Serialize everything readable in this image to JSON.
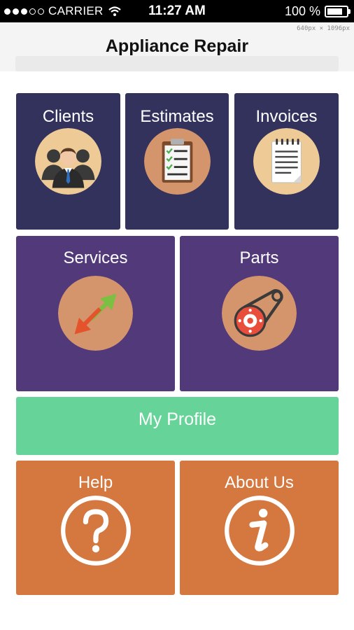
{
  "status_bar": {
    "carrier": "CARRIER",
    "time": "11:27 AM",
    "battery": "100 %"
  },
  "header": {
    "title": "Appliance Repair",
    "dimension_note": "640px × 1096px"
  },
  "tiles": {
    "clients": "Clients",
    "estimates": "Estimates",
    "invoices": "Invoices",
    "services": "Services",
    "parts": "Parts",
    "my_profile": "My Profile",
    "help": "Help",
    "about_us": "About Us"
  },
  "colors": {
    "navy_tile": "#33325c",
    "purple_tile": "#52397a",
    "green_tile": "#66d399",
    "orange_tile": "#d4783f",
    "icon_circle": "#d4956c",
    "icon_circle_light": "#eecb96"
  },
  "icons": {
    "clients": "people-group-icon",
    "estimates": "clipboard-checklist-icon",
    "invoices": "notepad-icon",
    "services": "double-arrow-icon",
    "parts": "belt-pulley-icon",
    "help": "question-mark-icon",
    "about_us": "info-icon"
  }
}
